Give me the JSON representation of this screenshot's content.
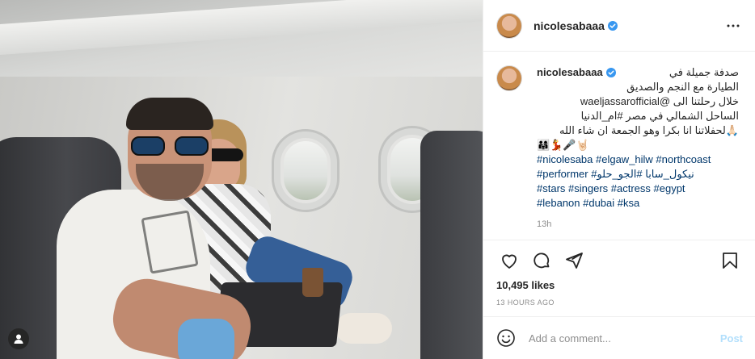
{
  "post": {
    "username": "nicolesabaaa",
    "verified_icon": "verified-badge-icon",
    "more_icon": "more-options-icon"
  },
  "caption": {
    "username": "nicolesabaaa",
    "line1": "صدفة جميلة في",
    "line2": "الطيارة مع النجم والصديق",
    "line3": "خلال رحلتنا الى @waeljassarofficial",
    "line4": "الساحل الشمالي في مصر #ام_الدنيا",
    "line5": "🙏🏻لحفلاتنا انا بكرا وهو الجمعة ان شاء الله",
    "line6": "👨‍👩‍👧💃🎤🤘🏻",
    "hashtags1": "#nicolesaba #elgaw_hilw #northcoast",
    "hashtags2": "#performer #نيكول_سابا #الجو_حلو",
    "hashtags3": "#stars #singers #actress #egypt",
    "hashtags4": "#lebanon #dubai #ksa",
    "time_small": "13h"
  },
  "actions": {
    "like_icon": "heart-icon",
    "comment_icon": "comment-icon",
    "share_icon": "share-icon",
    "save_icon": "bookmark-icon"
  },
  "likes": "10,495 likes",
  "posted_ago": "13 HOURS AGO",
  "add_comment": {
    "emoji_icon": "emoji-icon",
    "placeholder": "Add a comment...",
    "post_label": "Post"
  },
  "colors": {
    "link": "#00376b",
    "verified": "#3897f0",
    "post_disabled": "#b2dffc",
    "muted": "#8e8e8e"
  }
}
